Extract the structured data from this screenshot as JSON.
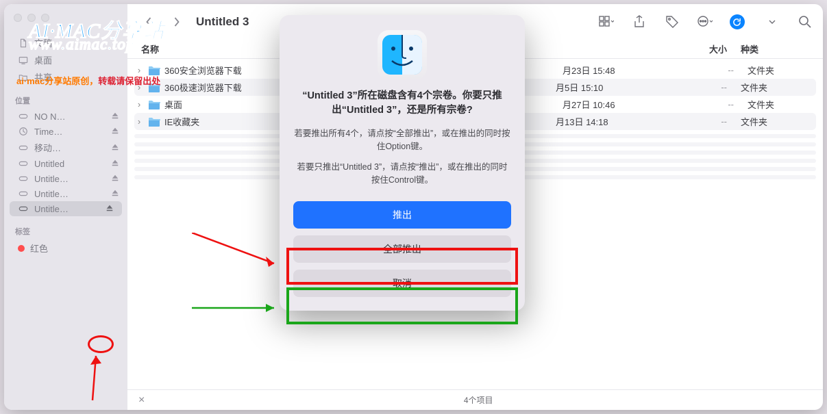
{
  "window_title": "Untitled 3",
  "sidebar": {
    "fav": [
      {
        "icon": "doc",
        "label": "文稿"
      },
      {
        "icon": "desktop",
        "label": "桌面"
      },
      {
        "icon": "folder",
        "label": "共享"
      }
    ],
    "locations_header": "位置",
    "locations": [
      {
        "label": "NO N…",
        "eject": true
      },
      {
        "label": "Time…",
        "eject": true
      },
      {
        "label": "移动…",
        "eject": true
      },
      {
        "label": "Untitled",
        "eject": true
      },
      {
        "label": "Untitle…",
        "eject": true
      },
      {
        "label": "Untitle…",
        "eject": true
      },
      {
        "label": "Untitle…",
        "eject": true,
        "selected": true
      }
    ],
    "tags_header": "标签",
    "tags": [
      {
        "label": "红色"
      }
    ]
  },
  "columns": {
    "name": "名称",
    "date": "",
    "size": "大小",
    "kind": "种类"
  },
  "rows": [
    {
      "name": "360安全浏览器下载",
      "date": "月23日 15:48",
      "size": "--",
      "kind": "文件夹"
    },
    {
      "name": "360极速浏览器下载",
      "date": "月5日 15:10",
      "size": "--",
      "kind": "文件夹"
    },
    {
      "name": "桌面",
      "date": "月27日 10:46",
      "size": "--",
      "kind": "文件夹"
    },
    {
      "name": "IE收藏夹",
      "date": "月13日 14:18",
      "size": "--",
      "kind": "文件夹"
    }
  ],
  "status": {
    "close": "×",
    "count": "4个项目"
  },
  "dialog": {
    "title": "“Untitled 3”所在磁盘含有4个宗卷。你要只推出“Untitled 3”，还是所有宗卷?",
    "body1": "若要推出所有4个，请点按“全部推出”，或在推出的同时按住Option键。",
    "body2": "若要只推出“Untitled 3”，请点按“推出”，或在推出的同时按住Control键。",
    "btn_primary": "推出",
    "btn_all": "全部推出",
    "btn_cancel": "取消"
  },
  "watermark": {
    "l1": "AI·MAC分享站",
    "l2": "www.aimac.top",
    "l3a": "ai·mac分享站原创，",
    "l3b": "转载请保留出处"
  }
}
